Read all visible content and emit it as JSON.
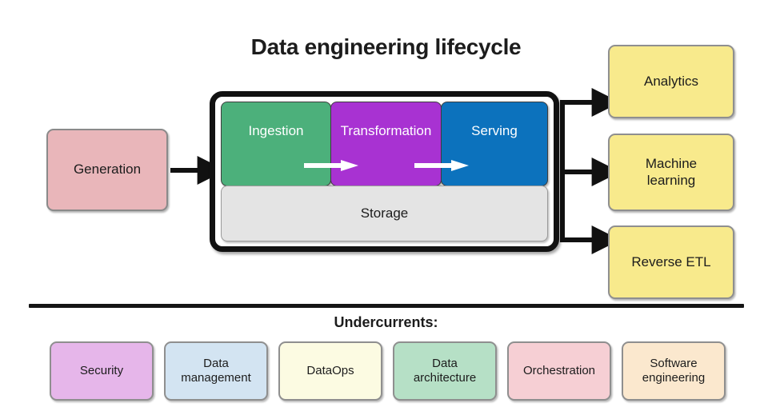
{
  "diagram": {
    "title": "Data engineering lifecycle",
    "generation": {
      "label": "Generation",
      "color": "#e9b6ba"
    },
    "stages": [
      {
        "label": "Ingestion",
        "color": "#4cb07b",
        "text_color": "#ffffff"
      },
      {
        "label": "Transformation",
        "color": "#a832d2",
        "text_color": "#ffffff"
      },
      {
        "label": "Serving",
        "color": "#0c72bd",
        "text_color": "#ffffff"
      }
    ],
    "storage": {
      "label": "Storage",
      "color": "#e4e4e4"
    },
    "outputs": [
      {
        "label": "Analytics",
        "color": "#f8ea8c"
      },
      {
        "label": "Machine\nlearning",
        "line1": "Machine",
        "line2": "learning",
        "color": "#f8ea8c"
      },
      {
        "label": "Reverse ETL",
        "color": "#f8ea8c"
      }
    ],
    "undercurrents": {
      "label": "Undercurrents:",
      "items": [
        {
          "label": "Security",
          "line1": "Security",
          "line2": "",
          "color": "#e6b6ea"
        },
        {
          "label": "Data management",
          "line1": "Data",
          "line2": "management",
          "color": "#d3e4f2"
        },
        {
          "label": "DataOps",
          "line1": "DataOps",
          "line2": "",
          "color": "#fcfbe2"
        },
        {
          "label": "Data architecture",
          "line1": "Data",
          "line2": "architecture",
          "color": "#b6e0c6"
        },
        {
          "label": "Orchestration",
          "line1": "Orchestration",
          "line2": "",
          "color": "#f6cfd4"
        },
        {
          "label": "Software engineering",
          "line1": "Software",
          "line2": "engineering",
          "color": "#fbe8ce"
        }
      ]
    },
    "flow": {
      "arrow_color": "#111111",
      "inner_arrow_color": "#ffffff"
    }
  }
}
